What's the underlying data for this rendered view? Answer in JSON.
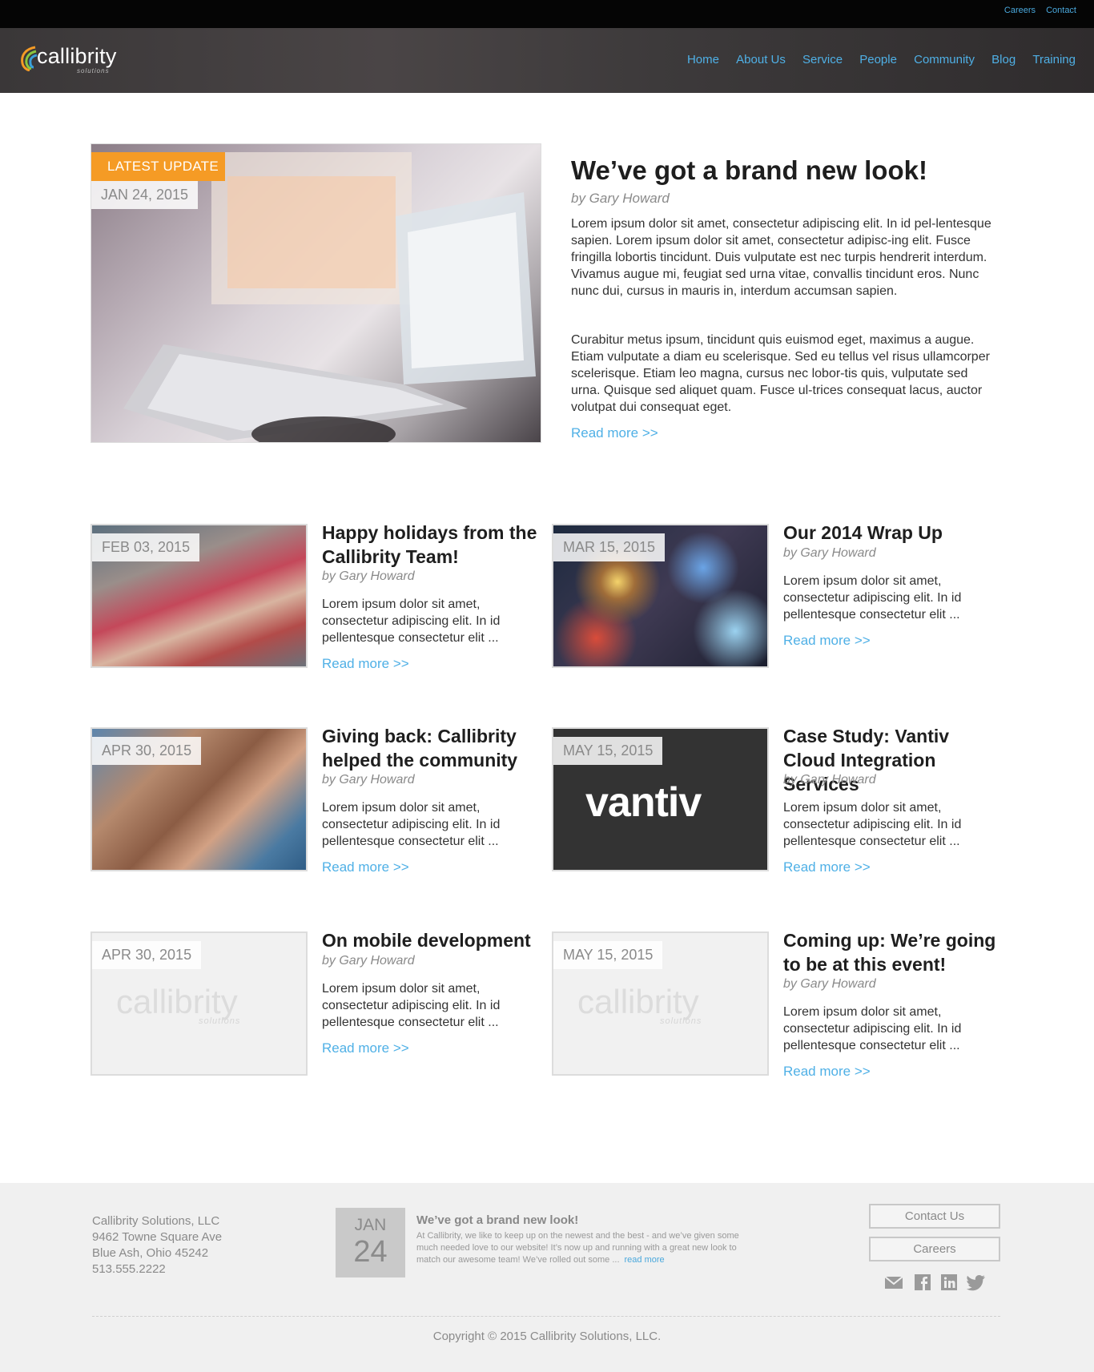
{
  "topbar": {
    "links": [
      "Careers",
      "Contact"
    ]
  },
  "header": {
    "logo_text": "callibrity",
    "logo_sub": "solutions",
    "nav": [
      "Home",
      "About Us",
      "Service",
      "People",
      "Community",
      "Blog",
      "Training"
    ]
  },
  "featured": {
    "badge": "LATEST UPDATE",
    "date": "JAN 24, 2015",
    "title": "We’ve got a brand new look!",
    "byline": "by Gary Howard",
    "paragraph1": "Lorem ipsum dolor sit amet, consectetur adipiscing elit. In id pel-lentesque sapien. Lorem ipsum dolor sit amet, consectetur adipisc-ing elit. Fusce fringilla lobortis tincidunt. Duis vulputate est nec turpis hendrerit interdum. Vivamus augue mi, feugiat sed urna vitae, convallis tincidunt eros. Nunc nunc dui, cursus in mauris in, interdum accumsan sapien.",
    "paragraph2": "Curabitur metus ipsum, tincidunt quis euismod eget, maximus a augue. Etiam vulputate a diam eu scelerisque. Sed eu tellus vel risus ullamcorper scelerisque. Etiam leo magna, cursus nec lobor-tis quis, vulputate sed urna. Quisque sed aliquet quam. Fusce ul-trices consequat lacus, auctor volutpat dui consequat eget.",
    "read_more": "Read more >>"
  },
  "posts": [
    {
      "date": "FEB 03, 2015",
      "title": "Happy holidays from the Callibrity Team!",
      "byline": "by Gary Howard",
      "excerpt": "Lorem ipsum dolor sit amet, consectetur adipiscing elit. In id pellentesque consectetur elit ...",
      "read_more": "Read more >>"
    },
    {
      "date": "MAR 15, 2015",
      "title": "Our 2014 Wrap Up",
      "byline": "by Gary Howard",
      "excerpt": "Lorem ipsum dolor sit amet, consectetur adipiscing elit. In id pellentesque consectetur elit ...",
      "read_more": "Read more >>"
    },
    {
      "date": "APR 30, 2015",
      "title": "Giving back: Callibrity helped the community",
      "byline": "by Gary Howard",
      "excerpt": "Lorem ipsum dolor sit amet, consectetur adipiscing elit. In id pellentesque consectetur elit ...",
      "read_more": "Read more >>"
    },
    {
      "date": "MAY 15, 2015",
      "title": "Case Study: Vantiv Cloud Integration Services",
      "byline": "by Gary Howard",
      "excerpt": "Lorem ipsum dolor sit amet, consectetur adipiscing elit. In id pellentesque consectetur elit ...",
      "read_more": "Read more >>",
      "image_text": "vantiv"
    },
    {
      "date": "APR 30, 2015",
      "title": "On mobile development",
      "byline": "by Gary Howard",
      "excerpt": "Lorem ipsum dolor sit amet, consectetur adipiscing elit. In id pellentesque consectetur elit ...",
      "read_more": "Read more >>",
      "image_text": "callibrity",
      "image_sub": "solutions"
    },
    {
      "date": "MAY 15, 2015",
      "title": "Coming up: We’re going to be at this event!",
      "byline": "by Gary Howard",
      "excerpt": "Lorem ipsum dolor sit amet, consectetur adipiscing elit. In id pellentesque consectetur elit ...",
      "read_more": "Read more >>",
      "image_text": "callibrity",
      "image_sub": "solutions"
    }
  ],
  "footer": {
    "company": "Callibrity Solutions, LLC",
    "street": "9462 Towne Square Ave",
    "city": "Blue Ash, Ohio 45242",
    "phone": "513.555.2222",
    "calendar_month": "JAN",
    "calendar_day": "24",
    "news_title": "We’ve got a brand new look!",
    "news_text": "At Callibrity, we like to keep up on the newest and the best - and we’ve given some much needed love to our website! It’s now up and running with a great new look to match our awesome team! We’ve rolled out some ...",
    "news_more": "read more",
    "contact_button": "Contact Us",
    "careers_button": "Careers",
    "social_icons": [
      "mail-icon",
      "facebook-icon",
      "linkedin-icon",
      "twitter-icon"
    ],
    "copyright": "Copyright © 2015 Callibrity Solutions, LLC."
  },
  "colors": {
    "accent": "#4fb0e6",
    "badge": "#f59b25",
    "footer_bg": "#f0f0f0",
    "topbar": "#050505"
  }
}
